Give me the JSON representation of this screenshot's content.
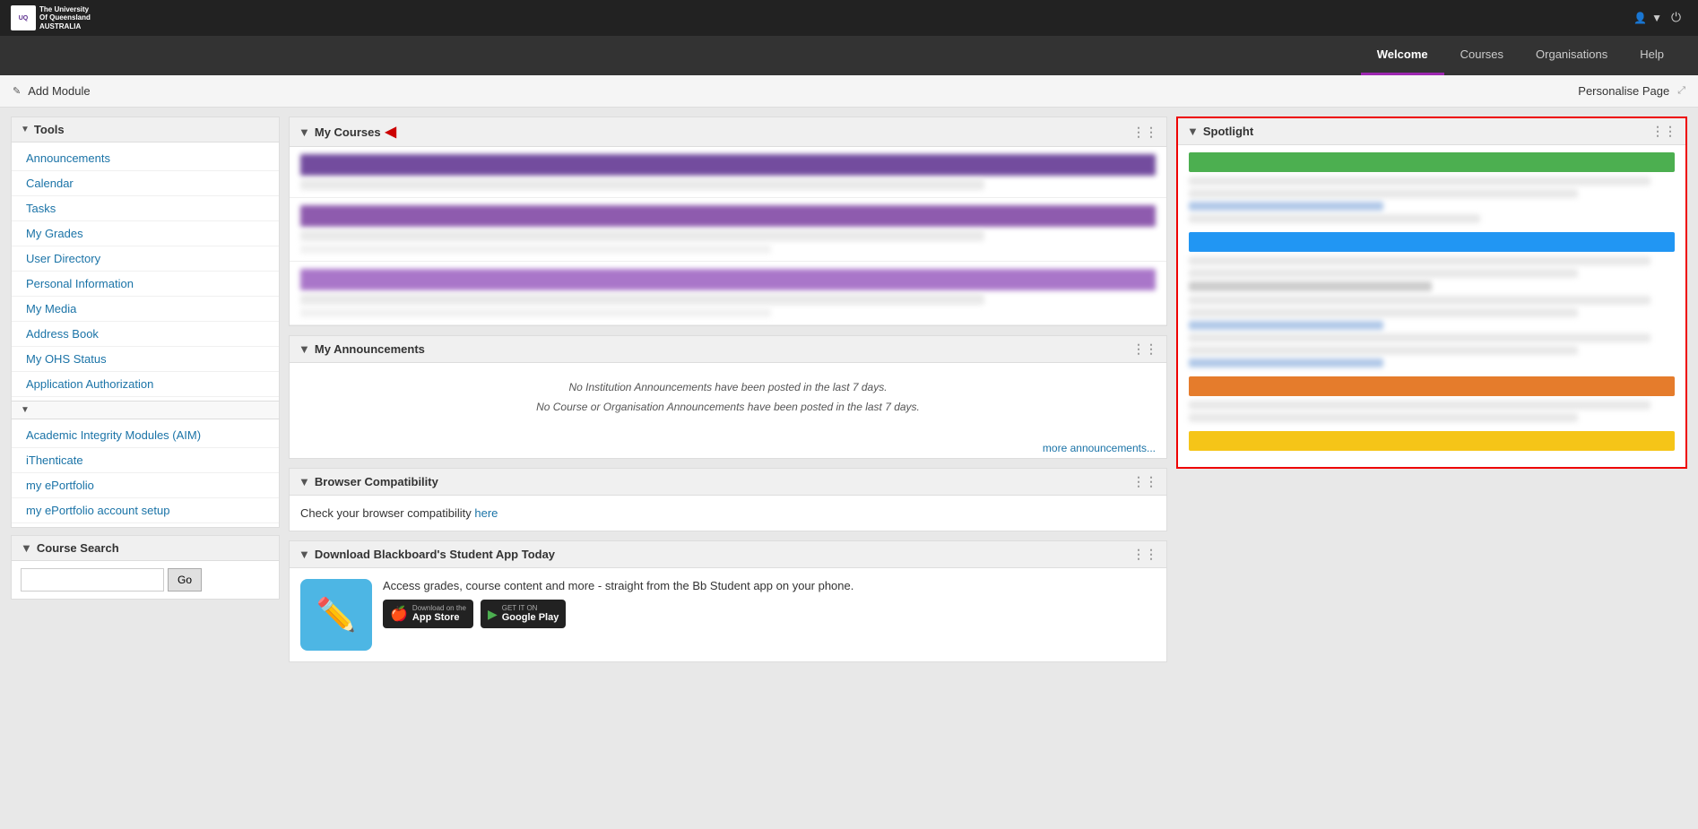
{
  "header": {
    "university_name": "The University\nOf Queensland\nAUSTRALIA",
    "nav_items": [
      {
        "label": "Welcome",
        "active": true
      },
      {
        "label": "Courses",
        "active": false
      },
      {
        "label": "Organisations",
        "active": false
      },
      {
        "label": "Help",
        "active": false
      }
    ]
  },
  "toolbar": {
    "add_module_label": "Add Module",
    "personalise_label": "Personalise Page"
  },
  "sidebar": {
    "tools_section": "Tools",
    "tools_items": [
      {
        "label": "Announcements"
      },
      {
        "label": "Calendar"
      },
      {
        "label": "Tasks"
      },
      {
        "label": "My Grades"
      },
      {
        "label": "User Directory"
      },
      {
        "label": "Personal Information"
      },
      {
        "label": "My Media"
      },
      {
        "label": "Address Book"
      },
      {
        "label": "My OHS Status"
      },
      {
        "label": "Application Authorization"
      }
    ],
    "extra_items": [
      {
        "label": "Academic Integrity Modules (AIM)"
      },
      {
        "label": "iThenticate"
      },
      {
        "label": "my ePortfolio"
      },
      {
        "label": "my ePortfolio account setup"
      }
    ],
    "course_search": {
      "title": "Course Search",
      "placeholder": "",
      "go_button": "Go"
    }
  },
  "my_courses": {
    "title": "My Courses",
    "courses": [
      {
        "color": "purple-dark"
      },
      {
        "color": "purple"
      },
      {
        "color": "purple-light"
      }
    ]
  },
  "my_announcements": {
    "title": "My Announcements",
    "no_institution": "No Institution Announcements have been posted in the last 7 days.",
    "no_course": "No Course or Organisation Announcements have been posted in the last 7 days.",
    "more_link": "more announcements..."
  },
  "browser_compatibility": {
    "title": "Browser Compatibility",
    "text": "Check your browser compatibility ",
    "link_text": "here"
  },
  "download_app": {
    "title": "Download Blackboard's Student App Today",
    "description": "Access grades, course content and more - straight from the Bb Student app on your phone.",
    "app_store_label_small": "Download on the",
    "app_store_label_large": "App Store",
    "google_play_label_small": "GET IT ON",
    "google_play_label_large": "Google Play"
  },
  "spotlight": {
    "title": "Spotlight",
    "bars": [
      {
        "color": "bar-green"
      },
      {
        "color": "bar-blue"
      },
      {
        "color": "bar-orange"
      },
      {
        "color": "bar-yellow"
      }
    ]
  }
}
